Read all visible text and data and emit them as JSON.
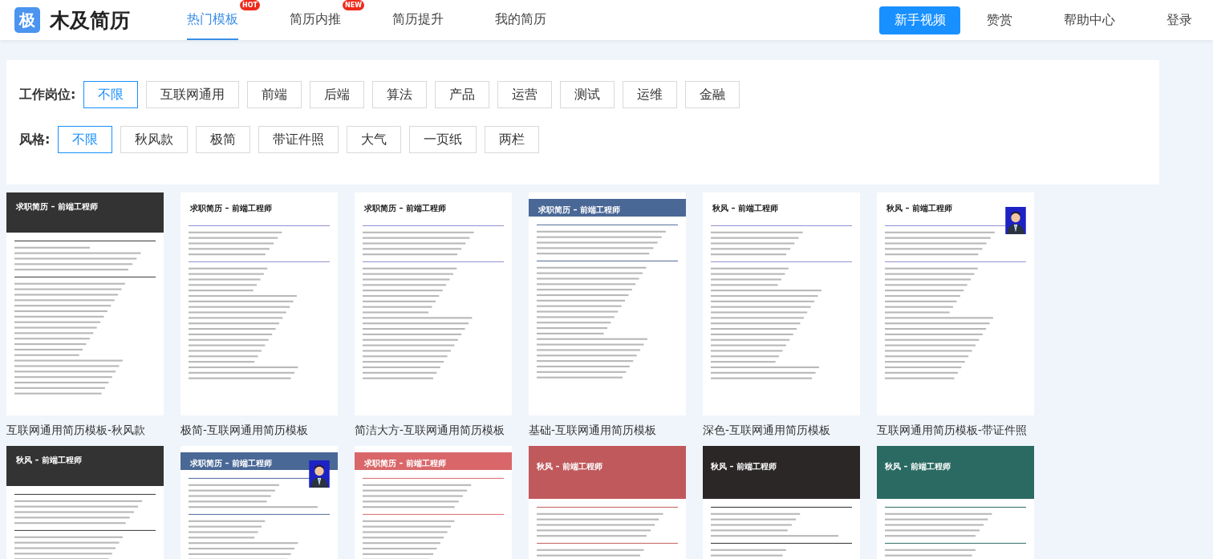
{
  "header": {
    "logo_mark": "极",
    "brand": "木及简历",
    "tabs": [
      {
        "label": "热门模板",
        "selected": true,
        "badge": "HOT"
      },
      {
        "label": "简历内推",
        "selected": false,
        "badge": "NEW"
      },
      {
        "label": "简历提升",
        "selected": false
      },
      {
        "label": "我的简历",
        "selected": false
      }
    ],
    "primary_button": "新手视频",
    "links": [
      "赞赏",
      "帮助中心",
      "登录"
    ]
  },
  "filters": [
    {
      "label": "工作岗位:",
      "options": [
        {
          "label": "不限",
          "selected": true
        },
        {
          "label": "互联网通用",
          "selected": false
        },
        {
          "label": "前端",
          "selected": false
        },
        {
          "label": "后端",
          "selected": false
        },
        {
          "label": "算法",
          "selected": false
        },
        {
          "label": "产品",
          "selected": false
        },
        {
          "label": "运营",
          "selected": false
        },
        {
          "label": "测试",
          "selected": false
        },
        {
          "label": "运维",
          "selected": false
        },
        {
          "label": "金融",
          "selected": false
        }
      ]
    },
    {
      "label": "风格:",
      "options": [
        {
          "label": "不限",
          "selected": true
        },
        {
          "label": "秋风款",
          "selected": false
        },
        {
          "label": "极简",
          "selected": false
        },
        {
          "label": "带证件照",
          "selected": false
        },
        {
          "label": "大气",
          "selected": false
        },
        {
          "label": "一页纸",
          "selected": false
        },
        {
          "label": "两栏",
          "selected": false
        }
      ]
    }
  ],
  "templates": [
    {
      "kind": "band",
      "color": "#333333",
      "title": "求职简历 – 前端工程师",
      "caption": "互联网通用简历模板-秋风款"
    },
    {
      "kind": "plain",
      "title": "求职简历 – 前端工程师",
      "caption": "极简-互联网通用简历模板"
    },
    {
      "kind": "plain",
      "title": "求职简历 – 前端工程师",
      "caption": "简洁大方-互联网通用简历模板"
    },
    {
      "kind": "bar",
      "color": "#4a6896",
      "title": "求职简历 – 前端工程师",
      "caption": "基础-互联网通用简历模板"
    },
    {
      "kind": "plain",
      "title": "秋风 – 前端工程师",
      "caption": "深色-互联网通用简历模板"
    },
    {
      "kind": "plain",
      "title": "秋风 – 前端工程师",
      "photo": true,
      "caption": "互联网通用简历模板-带证件照"
    },
    {
      "kind": "band",
      "color": "#333333",
      "title": "秋风 – 前端工程师"
    },
    {
      "kind": "bar",
      "color": "#4a6896",
      "title": "求职简历 – 前端工程师",
      "photo": true
    },
    {
      "kind": "bar",
      "color": "#d9676a",
      "title": "求职简历 – 前端工程师"
    },
    {
      "kind": "block",
      "color": "#c0595c",
      "title": "秋风 – 前端工程师"
    },
    {
      "kind": "block",
      "color": "#2b2727",
      "title": "秋风 – 前端工程师"
    },
    {
      "kind": "block",
      "color": "#2a6a62",
      "title": "秋风 – 前端工程师"
    }
  ]
}
